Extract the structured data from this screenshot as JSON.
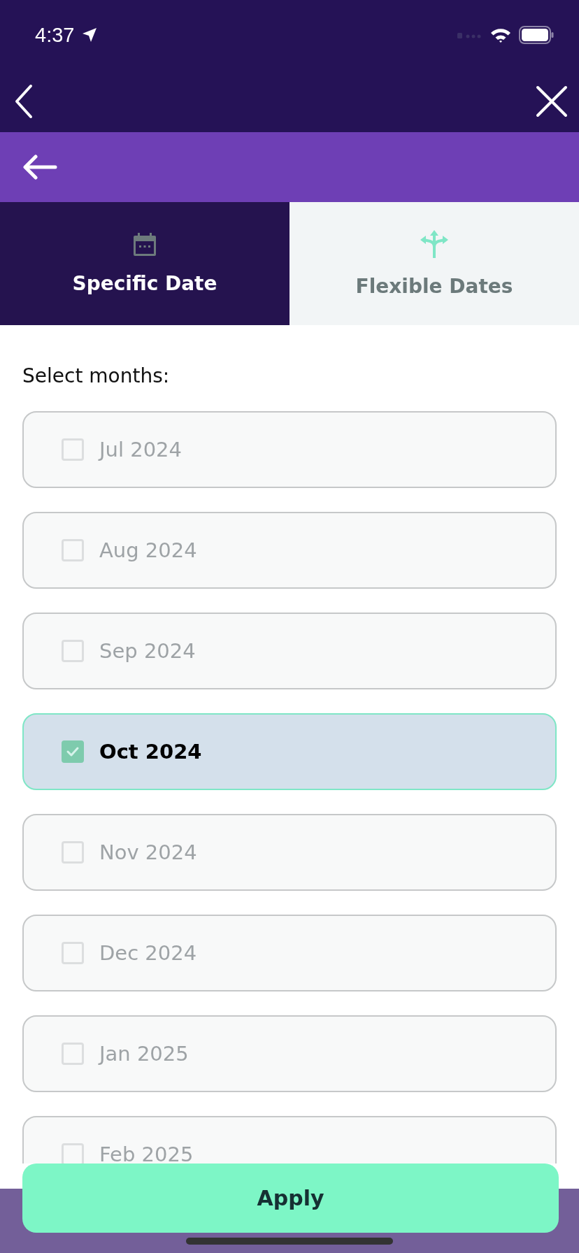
{
  "status_bar": {
    "time": "4:37"
  },
  "tabs": [
    {
      "label": "Specific Date",
      "selected": true
    },
    {
      "label": "Flexible Dates",
      "selected": false
    }
  ],
  "prompt": "Select months:",
  "months": [
    {
      "label": "Jul 2024",
      "checked": false
    },
    {
      "label": "Aug 2024",
      "checked": false
    },
    {
      "label": "Sep 2024",
      "checked": false
    },
    {
      "label": "Oct 2024",
      "checked": true
    },
    {
      "label": "Nov 2024",
      "checked": false
    },
    {
      "label": "Dec 2024",
      "checked": false
    },
    {
      "label": "Jan 2025",
      "checked": false
    },
    {
      "label": "Feb 2025",
      "checked": false
    }
  ],
  "apply_button": "Apply"
}
